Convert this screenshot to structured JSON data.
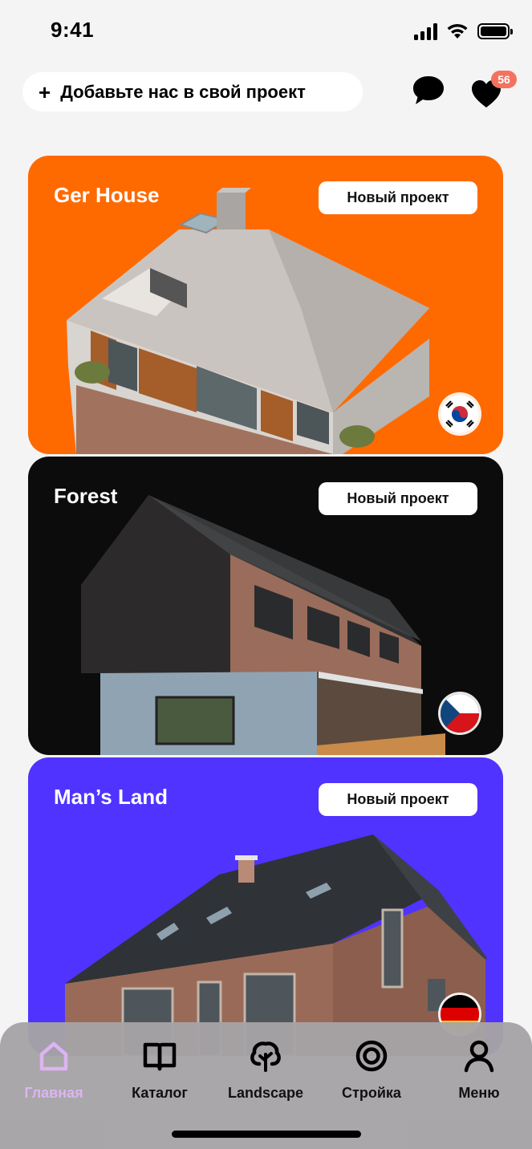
{
  "status_bar": {
    "time": "9:41"
  },
  "header": {
    "add_button_label": "Добавьте нас в свой проект",
    "add_icon": "plus-icon",
    "chat_icon": "chat-bubble-icon",
    "favorites_icon": "heart-icon",
    "favorites_count": "56"
  },
  "cards": [
    {
      "title": "Ger House",
      "button_label": "Новый проект",
      "background": "#ff6a00",
      "flag": "south-korea-flag-icon"
    },
    {
      "title": "Forest",
      "button_label": "Новый проект",
      "background": "#0c0c0c",
      "flag": "czech-flag-icon"
    },
    {
      "title": "Man’s Land",
      "button_label": "Новый проект",
      "background": "#5033ff",
      "flag": "germany-flag-icon"
    }
  ],
  "tabbar": {
    "items": [
      {
        "label": "Главная",
        "icon": "home-icon",
        "active": true
      },
      {
        "label": "Каталог",
        "icon": "book-icon",
        "active": false
      },
      {
        "label": "Landscape",
        "icon": "tree-icon",
        "active": false
      },
      {
        "label": "Стройка",
        "icon": "target-icon",
        "active": false
      },
      {
        "label": "Меню",
        "icon": "user-icon",
        "active": false
      }
    ],
    "active_color": "#ddb4f2"
  }
}
